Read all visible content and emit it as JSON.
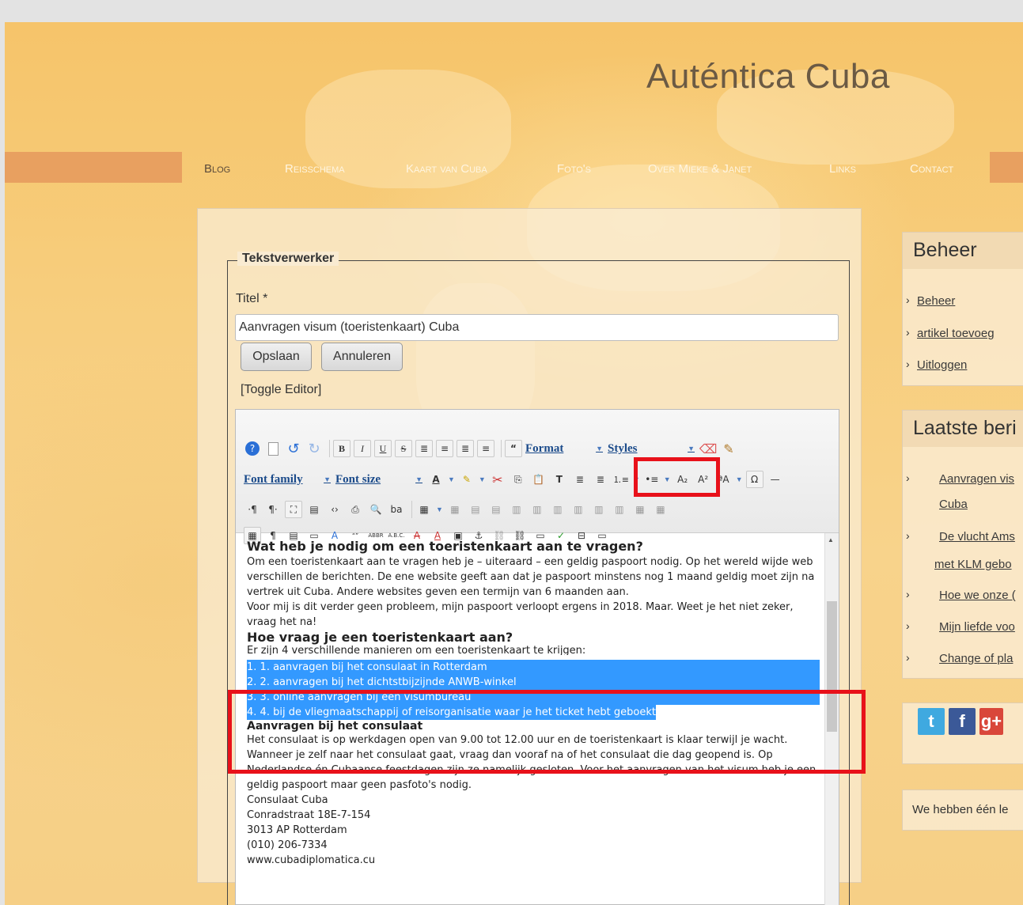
{
  "site": {
    "title": "Auténtica Cuba"
  },
  "nav": {
    "items": [
      {
        "label": "Blog",
        "active": true
      },
      {
        "label": "Reisschema"
      },
      {
        "label": "Kaart van Cuba"
      },
      {
        "label": "Foto's"
      },
      {
        "label": "Over Mieke & Janet"
      },
      {
        "label": "Links"
      },
      {
        "label": "Contact"
      }
    ]
  },
  "form": {
    "legend": "Tekstverwerker",
    "titel_label": "Titel *",
    "title_value": "Aanvragen visum (toeristenkaart) Cuba",
    "save_label": "Opslaan",
    "cancel_label": "Annuleren",
    "toggle_label": "[Toggle Editor]"
  },
  "toolbar": {
    "format_label": "Format",
    "styles_label": "Styles",
    "font_family_label": "Font family",
    "font_size_label": "Font size"
  },
  "content": {
    "h1": "Wat heb je nodig om een toeristenkaart aan te vragen?",
    "p1": "Om een toeristenkaart aan te vragen heb je – uiteraard – een geldig paspoort nodig. Op het wereld wijde web verschillen de berichten. De ene website geeft aan dat je paspoort minstens nog 1 maand geldig moet zijn na vertrek uit Cuba. Andere websites geven een termijn van 6 maanden aan.",
    "p2": "Voor mij is dit verder geen probleem, mijn paspoort verloopt ergens in 2018. Maar. Weet je het niet zeker, vraag het na!",
    "h2": "Hoe vraag je een toeristenkaart aan?",
    "p3": "Er zijn 4 verschillende manieren om een toeristenkaart te krijgen:",
    "list": [
      {
        "num": "1.",
        "text": "1. aanvragen bij het consulaat in Rotterdam"
      },
      {
        "num": "2.",
        "text": "2. aanvragen bij het dichtstbijzijnde ANWB-winkel"
      },
      {
        "num": "3.",
        "text": "3. online aanvragen bij een visumbureau"
      },
      {
        "num": "4.",
        "text": "4. bij de vliegmaatschappij of reisorganisatie waar je het ticket hebt geboekt"
      }
    ],
    "h3": "Aanvragen bij het consulaat",
    "p4": "Het consulaat is op werkdagen open van 9.00 tot 12.00 uur en de toeristenkaart is klaar terwijl je wacht. Wanneer je zelf naar het consulaat gaat, vraag dan vooraf na of het consulaat die dag geopend is. Op Nederlandse én Cubaanse feestdagen zijn ze namelijk gesloten. Voor het aanvragen van het visum heb je een geldig paspoort maar geen pasfoto's nodig.",
    "address": [
      "Consulaat Cuba",
      "Conradstraat 18E-7-154",
      "3013 AP Rotterdam",
      "(010) 206-7334",
      "www.cubadiplomatica.cu"
    ]
  },
  "sidebar": {
    "beheer": {
      "title": "Beheer",
      "links": [
        "Beheer",
        "artikel toevoeg",
        "Uitloggen"
      ]
    },
    "latest": {
      "title": "Laatste beri",
      "links": [
        "Aanvragen vis",
        "Cuba",
        "De vlucht Ams",
        "met KLM gebo",
        "Hoe we onze (",
        "Mijn liefde voo",
        "Change of pla"
      ]
    },
    "social": [
      "t",
      "f",
      "g+"
    ],
    "bottom_text": "We hebben één le"
  },
  "colors": {
    "accent_red": "#e8111a",
    "selection": "#3399ff",
    "nav_band": "#e8a060",
    "twitter": "#3fa9e0",
    "facebook": "#3b5998",
    "google": "#d9473a"
  }
}
